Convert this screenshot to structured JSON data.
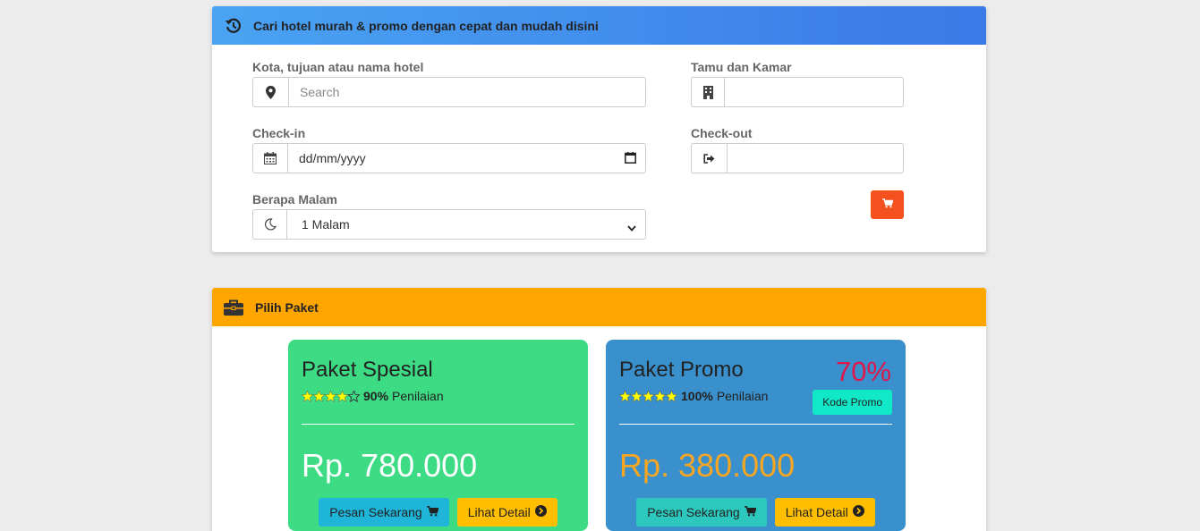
{
  "search_card": {
    "title": "Cari hotel murah & promo dengan cepat dan mudah disini",
    "icon": "history-icon",
    "fields": {
      "city": {
        "label": "Kota, tujuan atau nama hotel",
        "placeholder": "Search",
        "icon": "map-marker-icon"
      },
      "guests": {
        "label": "Tamu dan Kamar",
        "value": "",
        "icon": "building-icon"
      },
      "checkin": {
        "label": "Check-in",
        "value": "dd/mm/yyyy",
        "icon": "calendar-icon"
      },
      "checkout": {
        "label": "Check-out",
        "value": "",
        "icon": "sign-out-icon"
      },
      "nights": {
        "label": "Berapa Malam",
        "value": "1 Malam",
        "icon": "moon-icon"
      }
    },
    "cart_button": {
      "icon": "cart-icon",
      "color": "#f4511e"
    }
  },
  "paket_card": {
    "title": "Pilih Paket",
    "icon": "briefcase-icon",
    "packages": [
      {
        "name": "Paket Spesial",
        "rating_stars": 4,
        "rating_percent": "90%",
        "rating_label": "Penilaian",
        "price": "Rp. 780.000",
        "order_label": "Pesan Sekarang",
        "detail_label": "Lihat Detail",
        "bg_color": "#3ddc84"
      },
      {
        "name": "Paket Promo",
        "rating_stars": 5,
        "rating_percent": "100%",
        "rating_label": "Penilaian",
        "discount": "70%",
        "promo_code_label": "Kode Promo",
        "price": "Rp. 380.000",
        "order_label": "Pesan Sekarang",
        "detail_label": "Lihat Detail",
        "bg_color": "#3990cc"
      }
    ]
  }
}
